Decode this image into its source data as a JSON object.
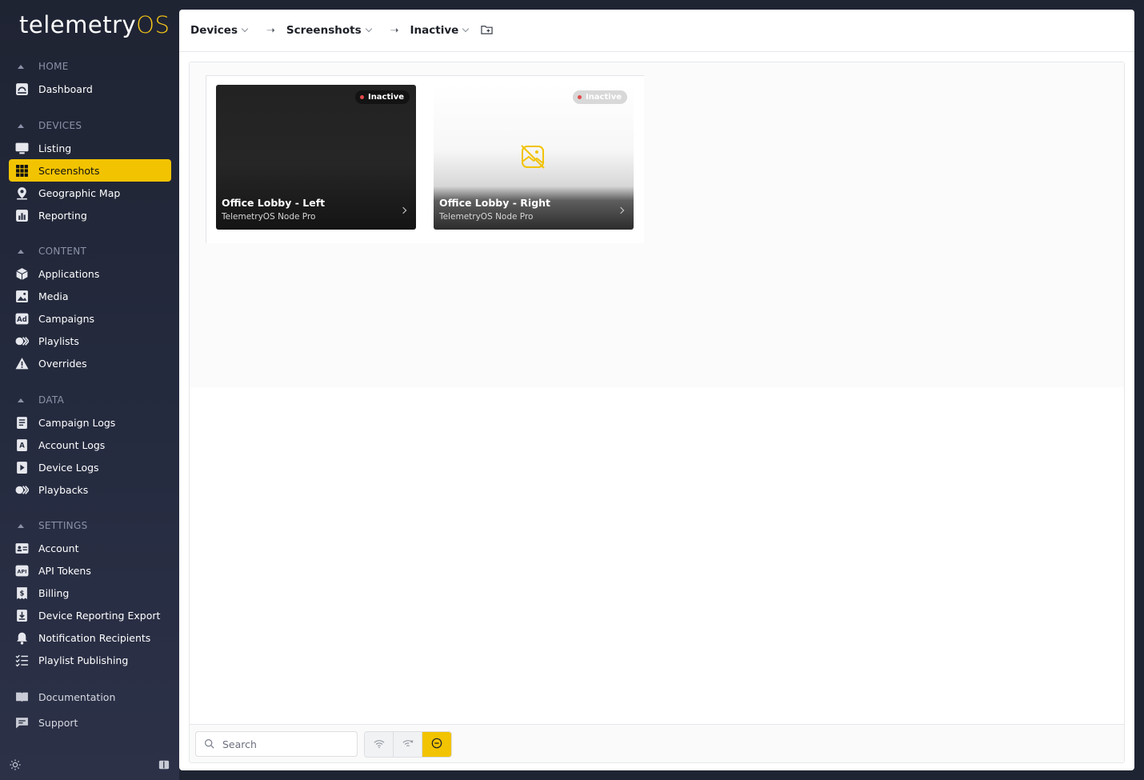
{
  "app": {
    "logo_main": "telemetry",
    "logo_accent": "OS",
    "accent_color": "#f2c300"
  },
  "sidebar": {
    "sections": [
      {
        "title": "HOME",
        "items": [
          {
            "label": "Dashboard",
            "icon": "dashboard-icon"
          }
        ]
      },
      {
        "title": "DEVICES",
        "items": [
          {
            "label": "Listing",
            "icon": "monitor-icon"
          },
          {
            "label": "Screenshots",
            "icon": "grid-icon",
            "active": true
          },
          {
            "label": "Geographic Map",
            "icon": "map-pin-icon"
          },
          {
            "label": "Reporting",
            "icon": "bar-chart-icon"
          }
        ]
      },
      {
        "title": "CONTENT",
        "items": [
          {
            "label": "Applications",
            "icon": "cube-icon"
          },
          {
            "label": "Media",
            "icon": "image-icon"
          },
          {
            "label": "Campaigns",
            "icon": "ad-icon"
          },
          {
            "label": "Playlists",
            "icon": "playlist-icon"
          },
          {
            "label": "Overrides",
            "icon": "warning-icon"
          }
        ]
      },
      {
        "title": "DATA",
        "items": [
          {
            "label": "Campaign Logs",
            "icon": "log-icon"
          },
          {
            "label": "Account Logs",
            "icon": "account-log-icon"
          },
          {
            "label": "Device Logs",
            "icon": "device-log-icon"
          },
          {
            "label": "Playbacks",
            "icon": "playback-icon"
          }
        ]
      },
      {
        "title": "SETTINGS",
        "items": [
          {
            "label": "Account",
            "icon": "id-card-icon"
          },
          {
            "label": "API Tokens",
            "icon": "api-icon"
          },
          {
            "label": "Billing",
            "icon": "billing-icon"
          },
          {
            "label": "Device Reporting Export",
            "icon": "download-icon"
          },
          {
            "label": "Notification Recipients",
            "icon": "bell-icon"
          },
          {
            "label": "Playlist Publishing",
            "icon": "checklist-icon"
          }
        ]
      }
    ],
    "extra": [
      {
        "label": "Documentation",
        "icon": "book-icon"
      },
      {
        "label": "Support",
        "icon": "chat-icon"
      }
    ]
  },
  "breadcrumb": {
    "items": [
      "Devices",
      "Screenshots",
      "Inactive"
    ]
  },
  "cards": [
    {
      "title": "Office Lobby - Left",
      "subtitle": "TelemetryOS Node Pro",
      "status": "Inactive"
    },
    {
      "title": "Office Lobby - Right",
      "subtitle": "TelemetryOS Node Pro",
      "status": "Inactive"
    }
  ],
  "footer": {
    "search_placeholder": "Search"
  }
}
